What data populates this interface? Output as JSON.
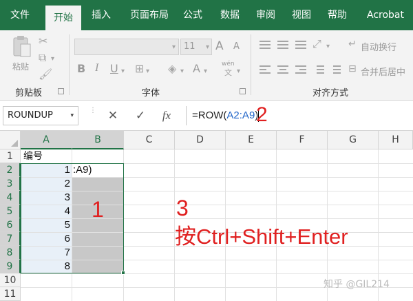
{
  "ribbon": {
    "tabs": [
      "文件",
      "开始",
      "插入",
      "页面布局",
      "公式",
      "数据",
      "审阅",
      "视图",
      "帮助",
      "Acrobat"
    ],
    "active_tab": "开始",
    "groups": {
      "clipboard": {
        "label": "剪贴板",
        "paste_label": "粘贴"
      },
      "font": {
        "label": "字体",
        "size": "11",
        "bold": "B",
        "italic": "I",
        "underline": "U",
        "font_grow": "A",
        "font_shrink": "A",
        "phonetic": "wén"
      },
      "alignment": {
        "label": "对齐方式",
        "wrap_text": "自动换行",
        "merge_center": "合并后居中"
      }
    },
    "accent": "#217346"
  },
  "formula_bar": {
    "name_box": "ROUNDUP",
    "cancel": "✕",
    "enter": "✓",
    "fx": "fx",
    "formula_prefix": "=ROW(",
    "formula_ref": "A2:A9",
    "formula_suffix": ")"
  },
  "sheet": {
    "columns": [
      "A",
      "B",
      "C",
      "D",
      "E",
      "F",
      "G",
      "H"
    ],
    "rows": [
      "1",
      "2",
      "3",
      "4",
      "5",
      "6",
      "7",
      "8",
      "9",
      "10",
      "11"
    ],
    "A1": "编号",
    "A_values": [
      "1",
      "2",
      "3",
      "4",
      "5",
      "6",
      "7",
      "8"
    ],
    "B2": ":A9)"
  },
  "annotations": {
    "n1": "1",
    "n2": "2",
    "n3": "3",
    "instruction": "按Ctrl+Shift+Enter",
    "color": "#e02020"
  },
  "watermark": "知乎 @GIL214"
}
